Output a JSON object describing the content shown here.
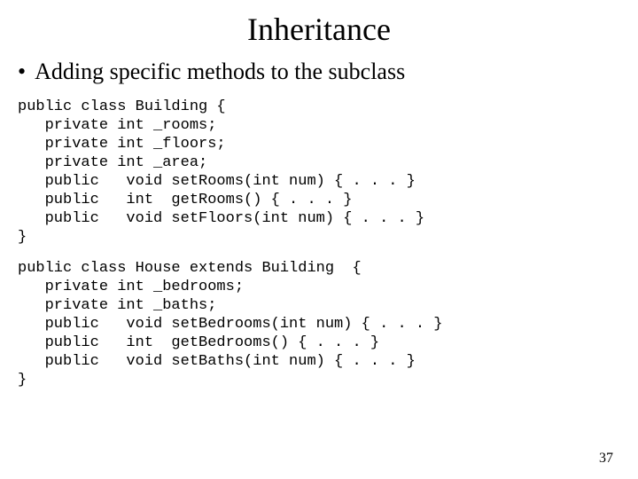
{
  "title": "Inheritance",
  "bullet": "Adding specific methods to the subclass",
  "code1": "public class Building {\n   private int _rooms;\n   private int _floors;\n   private int _area;\n   public   void setRooms(int num) { . . . }\n   public   int  getRooms() { . . . }\n   public   void setFloors(int num) { . . . }\n}",
  "code2": "public class House extends Building  {\n   private int _bedrooms;\n   private int _baths;\n   public   void setBedrooms(int num) { . . . }\n   public   int  getBedrooms() { . . . }\n   public   void setBaths(int num) { . . . }\n}",
  "pageNumber": "37"
}
